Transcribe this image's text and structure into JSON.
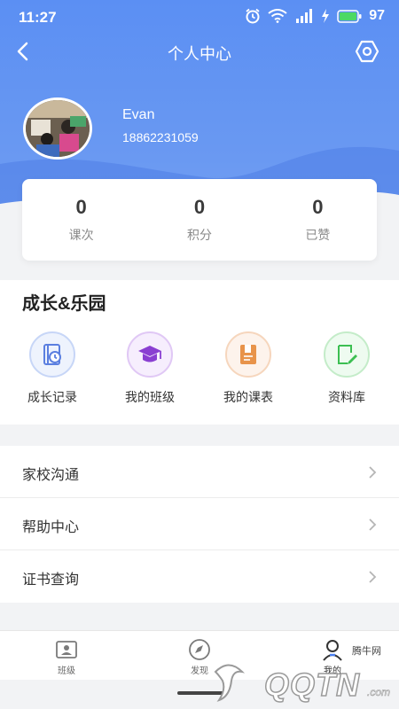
{
  "status_bar": {
    "time": "11:27",
    "battery": "97"
  },
  "nav": {
    "title": "个人中心"
  },
  "user": {
    "name": "Evan",
    "phone": "18862231059"
  },
  "stats": [
    {
      "value": "0",
      "label": "课次"
    },
    {
      "value": "0",
      "label": "积分"
    },
    {
      "value": "0",
      "label": "已赞"
    }
  ],
  "garden": {
    "title": "成长&乐园",
    "items": [
      {
        "label": "成长记录",
        "icon": "growth-record-icon",
        "color": "#5b7fe0"
      },
      {
        "label": "我的班级",
        "icon": "graduation-cap-icon",
        "color": "#8a3fd1"
      },
      {
        "label": "我的课表",
        "icon": "schedule-book-icon",
        "color": "#e8934a"
      },
      {
        "label": "资料库",
        "icon": "library-edit-icon",
        "color": "#3cbf52"
      }
    ]
  },
  "menu": [
    {
      "label": "家校沟通"
    },
    {
      "label": "帮助中心"
    },
    {
      "label": "证书查询"
    }
  ],
  "tabbar": [
    {
      "label": "班级",
      "icon": "class-icon"
    },
    {
      "label": "发现",
      "icon": "compass-icon"
    },
    {
      "label": "我的",
      "icon": "profile-icon",
      "active": true
    }
  ],
  "watermark": {
    "small": "腾牛网",
    "big": "QQTN",
    "sub": ".com"
  },
  "colors": {
    "header": "#5b8ff3",
    "accent": "#4a7ff0"
  }
}
